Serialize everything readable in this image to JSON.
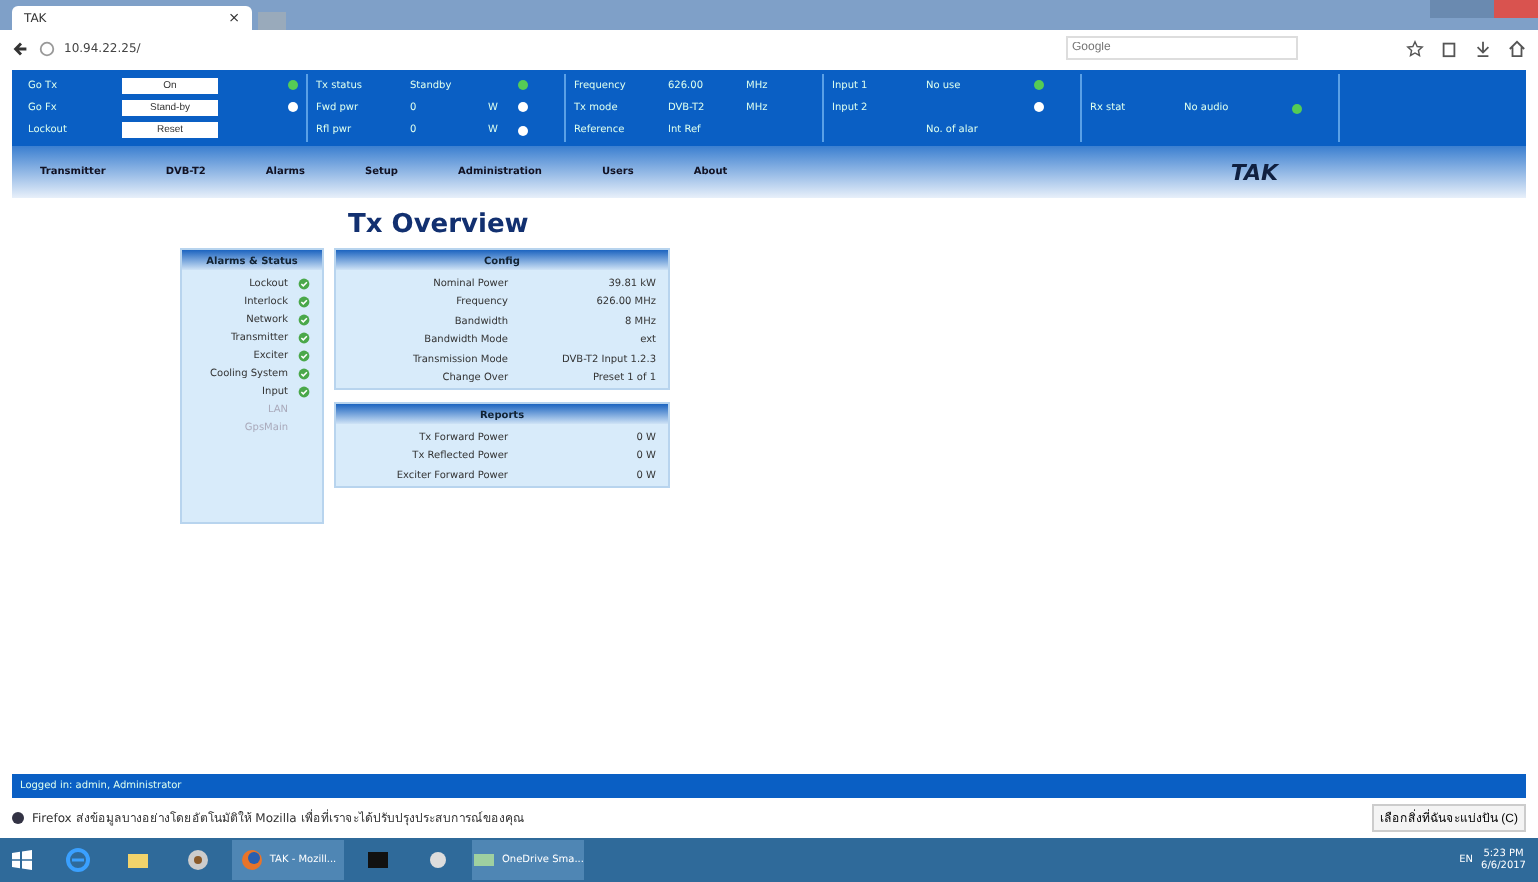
{
  "browser": {
    "tab_title": "TAK",
    "tab_close": "×",
    "url": "10.94.22.25/",
    "search_placeholder": "Google"
  },
  "header": {
    "controls": [
      {
        "label": "Go Tx",
        "button": "On",
        "lit": true
      },
      {
        "label": "Go Fx",
        "button": "Stand-by",
        "lit": false
      },
      {
        "label": "Lockout",
        "button": "Reset"
      }
    ],
    "groups": [
      {
        "rows": [
          {
            "label": "Tx status",
            "value": "Standby",
            "lit": true
          },
          {
            "label": "Fwd pwr",
            "value": "0",
            "unit": "W",
            "lit": false
          },
          {
            "label": "Rfl pwr",
            "value": "0",
            "unit": "W",
            "lit": false
          }
        ]
      },
      {
        "rows": [
          {
            "label": "Frequency",
            "value": "626.00",
            "unit": "MHz"
          },
          {
            "label": "Tx mode",
            "value": "DVB-T2",
            "unit": "MHz"
          },
          {
            "label": "Reference",
            "value": "Int Ref"
          }
        ]
      },
      {
        "rows": [
          {
            "label": "Input 1",
            "value": "No use",
            "lit": true
          },
          {
            "label": "Input 2",
            "lit": false
          },
          {
            "value": "No. of alar"
          }
        ]
      },
      {
        "rows": [
          {
            "label": "Rx stat",
            "value": "No audio",
            "lit": true
          }
        ]
      }
    ]
  },
  "nav": [
    "Transmitter",
    "DVB-T2",
    "Alarms",
    "Setup",
    "Administration",
    "Users",
    "About"
  ],
  "logo": "TAK",
  "page_title": "Tx Overview",
  "alarms": {
    "title": "Alarms & Status",
    "items": [
      {
        "label": "Lockout",
        "active": true
      },
      {
        "label": "Interlock",
        "active": true
      },
      {
        "label": "Network",
        "active": true
      },
      {
        "label": "Transmitter",
        "active": true
      },
      {
        "label": "Exciter",
        "active": true
      },
      {
        "label": "Cooling System",
        "active": true
      },
      {
        "label": "Input",
        "active": true
      },
      {
        "label": "LAN",
        "active": false
      },
      {
        "label": "GpsMain",
        "active": false
      }
    ]
  },
  "config": {
    "title": "Config",
    "rows": [
      {
        "label": "Nominal Power",
        "value": "39.81 kW"
      },
      {
        "label": "Frequency",
        "value": "626.00 MHz"
      },
      {
        "label": "Bandwidth",
        "value": "8 MHz"
      },
      {
        "label": "Bandwidth Mode",
        "value": "ext"
      },
      {
        "label": "Transmission Mode",
        "value": "DVB-T2 Input 1.2.3"
      },
      {
        "label": "Change Over",
        "value": "Preset 1 of 1"
      }
    ]
  },
  "reports": {
    "title": "Reports",
    "rows": [
      {
        "label": "Tx Forward Power",
        "value": "0 W"
      },
      {
        "label": "Tx Reflected Power",
        "value": "0 W"
      },
      {
        "label": "Exciter Forward Power",
        "value": "0 W"
      }
    ]
  },
  "footer": "Logged in: admin, Administrator",
  "notification": {
    "message": "Firefox ส่งข้อมูลบางอย่างโดยอัตโนมัติให้ Mozilla เพื่อที่เราจะได้ปรับปรุงประสบการณ์ของคุณ",
    "button": "เลือกสิ่งที่ฉันจะแบ่งปัน (C)"
  },
  "taskbar": {
    "items": [
      {
        "kind": "ie"
      },
      {
        "kind": "folder"
      },
      {
        "kind": "disc"
      },
      {
        "kind": "firefox",
        "label": "TAK - Mozill..."
      },
      {
        "kind": "terminal"
      },
      {
        "kind": "ball"
      },
      {
        "kind": "window",
        "label": "OneDrive Sma..."
      }
    ],
    "tray": "EN",
    "time": "5:23 PM",
    "date": "6/6/2017"
  }
}
